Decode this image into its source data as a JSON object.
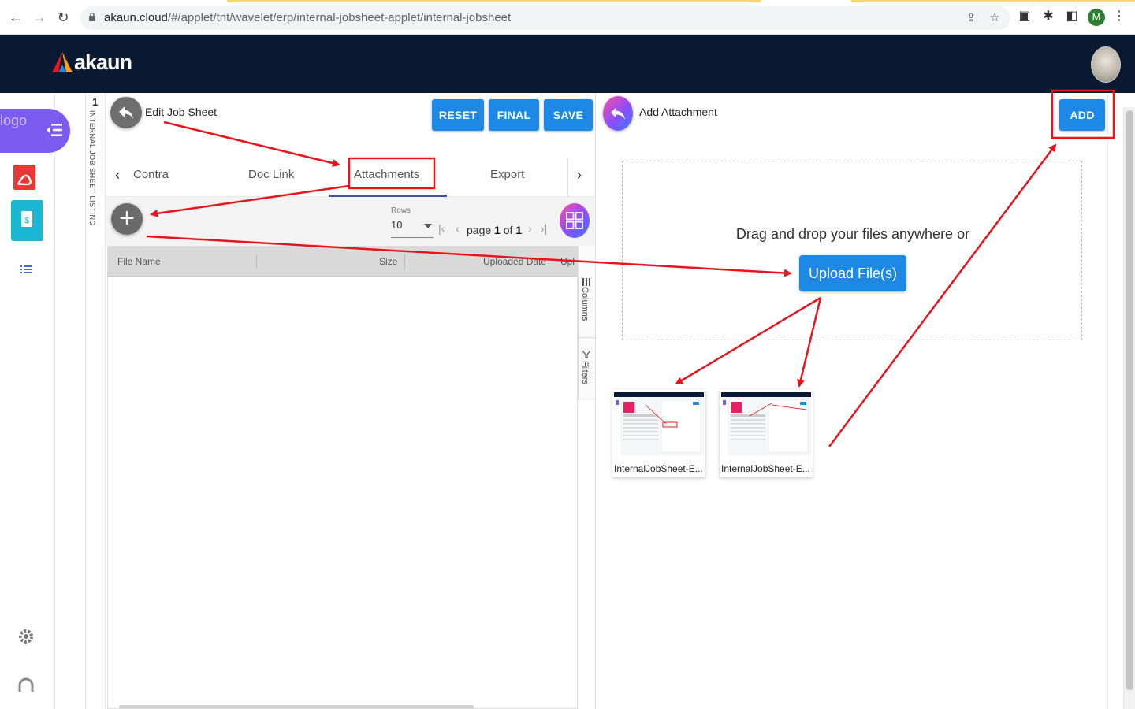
{
  "browser": {
    "url_host": "akaun.cloud",
    "url_path": "/#/applet/tnt/wavelet/erp/internal-jobsheet-applet/internal-jobsheet",
    "profile_initial": "M"
  },
  "app": {
    "brand_name": "akaun",
    "logo_alt": "logo"
  },
  "sheet_strip": {
    "number": "1",
    "label": "INTERNAL JOB SHEET LISTING"
  },
  "left_panel": {
    "title": "Edit Job Sheet",
    "buttons": {
      "reset": "RESET",
      "final": "FINAL",
      "save": "SAVE"
    },
    "tabs": [
      {
        "label": "Contra",
        "active": false
      },
      {
        "label": "Doc Link",
        "active": false
      },
      {
        "label": "Attachments",
        "active": true
      },
      {
        "label": "Export",
        "active": false
      }
    ],
    "pagination": {
      "rows_label": "Rows",
      "rows_value": "10",
      "page_word": "page",
      "page": "1",
      "of_word": "of",
      "total_pages": "1"
    },
    "grid": {
      "columns": [
        "File Name",
        "Size",
        "Uploaded Date",
        "Upl"
      ],
      "side_tools": {
        "columns": "Columns",
        "filters": "Filters"
      }
    }
  },
  "right_panel": {
    "title": "Add Attachment",
    "add_label": "ADD",
    "drop_text": "Drag and drop your files anywhere or",
    "upload_label": "Upload File(s)",
    "files": [
      {
        "name": "InternalJobSheet-E..."
      },
      {
        "name": "InternalJobSheet-E..."
      }
    ]
  },
  "colors": {
    "appbar": "#0a1a33",
    "primary_button": "#1e88e5",
    "annotation_red": "#e8141b",
    "tab_underline": "#3f51b5"
  }
}
